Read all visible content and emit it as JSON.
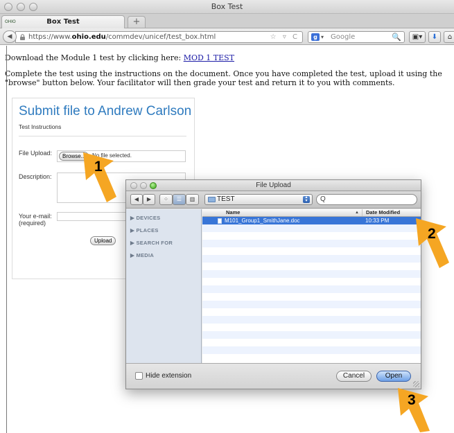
{
  "window": {
    "title": "Box Test"
  },
  "tabs": [
    {
      "label": "Box Test",
      "favicon_text": "OHIO"
    }
  ],
  "toolbar": {
    "back": "◀",
    "new_tab": "+",
    "url_prefix": "https://www.",
    "url_domain": "ohio.edu",
    "url_path": "/commdev/unicef/test_box.html",
    "url_icons": "☆ ▿ C",
    "search_engine": "g",
    "search_placeholder": "Google",
    "search_icon": "🔍",
    "home_label": "⌂",
    "download_label": "⬇",
    "addon_label": "▣▾"
  },
  "page": {
    "download_text": "Download the Module 1 test by clicking here: ",
    "download_link": "MOD 1 TEST",
    "instructions": "Complete the test using the instructions on the document. Once you have completed the test, upload it using the \"browse\" button below. Your facilitator will then grade your test and return it to you with comments."
  },
  "form": {
    "title": "Submit file to Andrew Carlson",
    "subtitle": "Test Instructions",
    "file_label": "File Upload:",
    "browse_label": "Browse...",
    "no_file_text": "No file selected.",
    "description_label": "Description:",
    "email_label": "Your e-mail: (required)",
    "upload_label": "Upload"
  },
  "dialog": {
    "title": "File Upload",
    "folder": "TEST",
    "search_icon": "Q",
    "sidebar": [
      "DEVICES",
      "PLACES",
      "SEARCH FOR",
      "MEDIA"
    ],
    "columns": {
      "name": "Name",
      "date": "Date Modified"
    },
    "files": [
      {
        "name": "M101_Group1_SmithJane.doc",
        "date": "10:33 PM",
        "selected": true
      }
    ],
    "hide_extension_label": "Hide extension",
    "cancel_label": "Cancel",
    "open_label": "Open"
  },
  "callouts": [
    "1",
    "2",
    "3"
  ],
  "colors": {
    "form_title": "#2f7bbf",
    "selected_row": "#3875d7",
    "callout_arrow": "#f5a623"
  }
}
